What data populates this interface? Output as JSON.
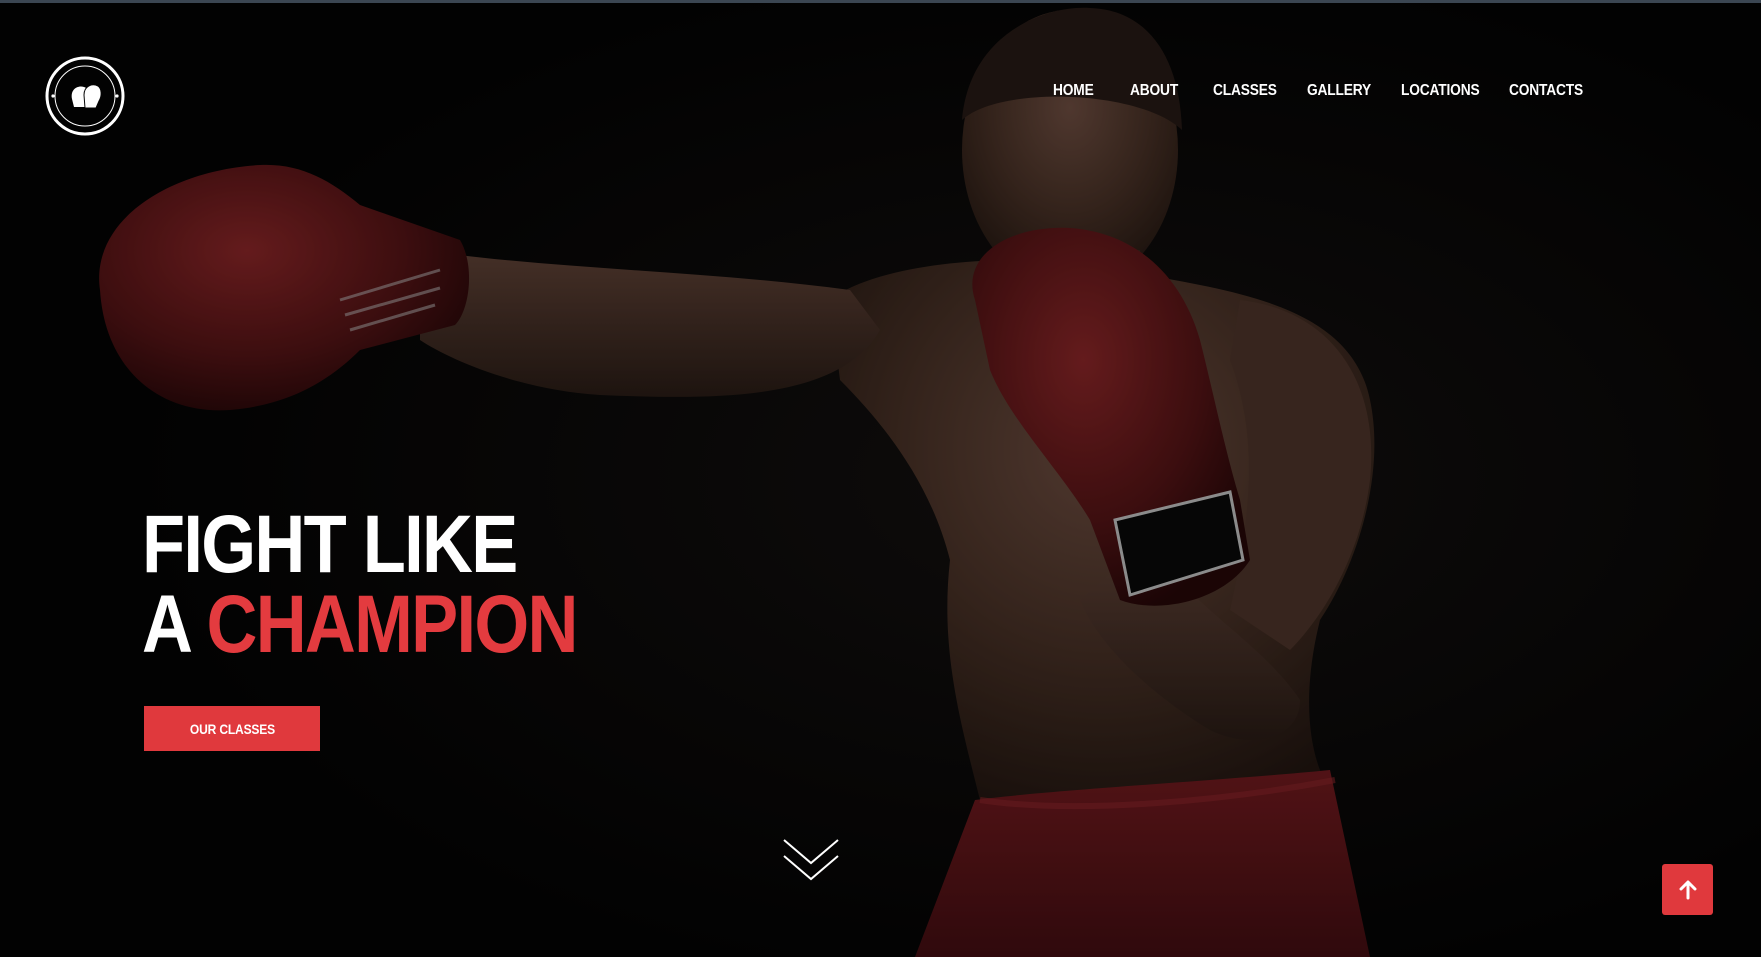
{
  "brand": {
    "logo_text": "BOXING",
    "accent_color": "#e0393d"
  },
  "nav": {
    "items": [
      {
        "label": "HOME"
      },
      {
        "label": "ABOUT"
      },
      {
        "label": "CLASSES"
      },
      {
        "label": "GALLERY"
      },
      {
        "label": "LOCATIONS"
      },
      {
        "label": "CONTACTS"
      }
    ]
  },
  "hero": {
    "line1": "FIGHT LIKE",
    "line2_prefix": "A",
    "line2_accent": "CHAMPION",
    "cta_label": "OUR CLASSES",
    "image_subject": "boxer-in-red-gloves"
  },
  "icons": {
    "scroll_down": "chevron-double-down-icon",
    "back_to_top": "arrow-up-icon"
  }
}
